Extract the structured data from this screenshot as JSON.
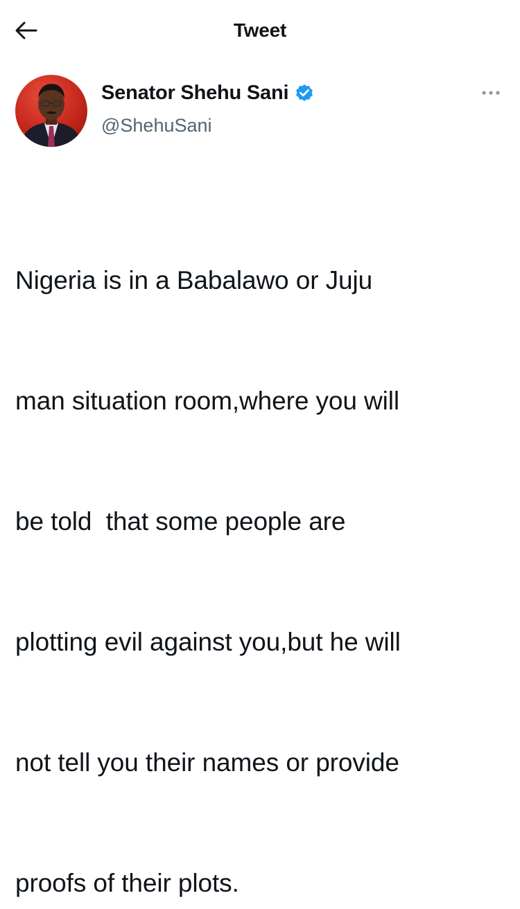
{
  "header": {
    "title": "Tweet",
    "back_icon": "arrow-left-icon"
  },
  "author": {
    "display_name": "Senator Shehu Sani",
    "handle": "@ShehuSani",
    "verified_icon": "verified-badge-icon",
    "avatar_icon": "avatar",
    "more_icon": "more-options-icon"
  },
  "colors": {
    "text": "#0f1419",
    "secondary_text": "#536471",
    "verified_blue": "#1d9bf0",
    "avatar_red": "#c4271b"
  },
  "tweet": {
    "lines": [
      "Nigeria is in a Babalawo or Juju",
      "man situation room,where you will",
      "be told  that some people are",
      "plotting evil against you,but he will",
      "not tell you their names or provide",
      "proofs of their plots."
    ]
  }
}
